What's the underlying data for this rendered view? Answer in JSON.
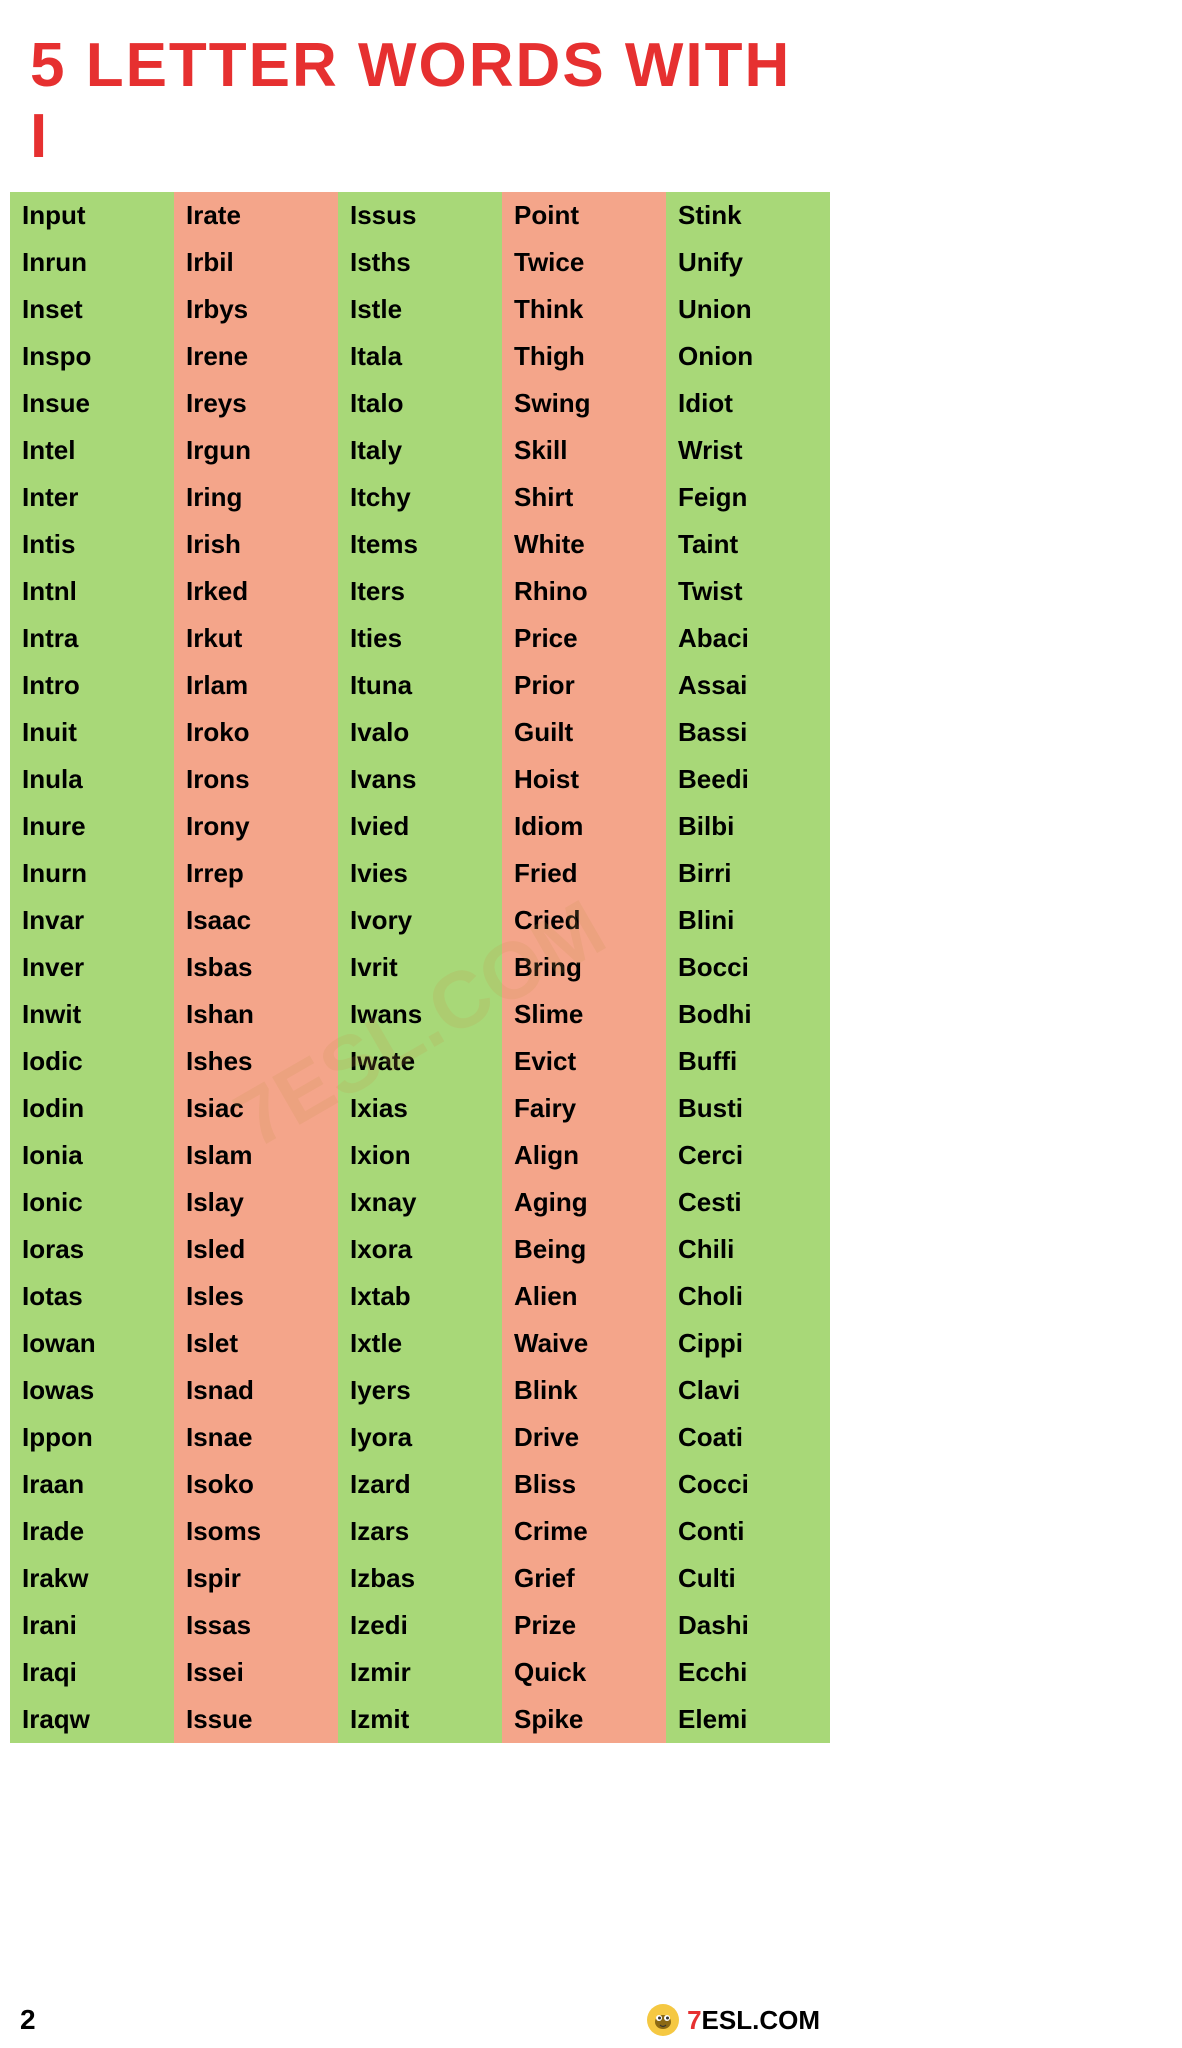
{
  "header": {
    "title": "5 LETTER WORDS WITH I"
  },
  "footer": {
    "page": "2",
    "logo_text": "ESL.COM"
  },
  "columns": [
    {
      "color_pattern": "green",
      "items": [
        "Input",
        "Inrun",
        "Inset",
        "Inspo",
        "Insue",
        "Intel",
        "Inter",
        "Intis",
        "Intnl",
        "Intra",
        "Intro",
        "Inuit",
        "Inula",
        "Inure",
        "Inurn",
        "Invar",
        "Inver",
        "Inwit",
        "Iodic",
        "Iodin",
        "Ionia",
        "Ionic",
        "Ioras",
        "Iotas",
        "Iowan",
        "Iowas",
        "Ippon",
        "Iraan",
        "Irade",
        "Irakw",
        "Irani",
        "Iraqi",
        "Iraqw"
      ]
    },
    {
      "color_pattern": "salmon",
      "items": [
        "Irate",
        "Irbil",
        "Irbys",
        "Irene",
        "Ireys",
        "Irgun",
        "Iring",
        "Irish",
        "Irked",
        "Irkut",
        "Irlam",
        "Iroko",
        "Irons",
        "Irony",
        "Irrep",
        "Isaac",
        "Isbas",
        "Ishan",
        "Ishes",
        "Isiac",
        "Islam",
        "Islay",
        "Isled",
        "Isles",
        "Islet",
        "Isnad",
        "Isnae",
        "Isoko",
        "Isoms",
        "Ispir",
        "Issas",
        "Issei",
        "Issue"
      ]
    },
    {
      "color_pattern": "green",
      "items": [
        "Issus",
        "Isths",
        "Istle",
        "Itala",
        "Italo",
        "Italy",
        "Itchy",
        "Items",
        "Iters",
        "Ities",
        "Ituna",
        "Ivalo",
        "Ivans",
        "Ivied",
        "Ivies",
        "Ivory",
        "Ivrit",
        "Iwans",
        "Iwate",
        "Ixias",
        "Ixion",
        "Ixnay",
        "Ixora",
        "Ixtab",
        "Ixtle",
        "Iyers",
        "Iyora",
        "Izard",
        "Izars",
        "Izbas",
        "Izedi",
        "Izmir",
        "Izmit"
      ]
    },
    {
      "color_pattern": "salmon",
      "items": [
        "Point",
        "Twice",
        "Think",
        "Thigh",
        "Swing",
        "Skill",
        "Shirt",
        "White",
        "Rhino",
        "Price",
        "Prior",
        "Guilt",
        "Hoist",
        "Idiom",
        "Fried",
        "Cried",
        "Bring",
        "Slime",
        "Evict",
        "Fairy",
        "Align",
        "Aging",
        "Being",
        "Alien",
        "Waive",
        "Blink",
        "Drive",
        "Bliss",
        "Crime",
        "Grief",
        "Prize",
        "Quick",
        "Spike"
      ]
    },
    {
      "color_pattern": "green",
      "items": [
        "Stink",
        "Unify",
        "Union",
        "Onion",
        "Idiot",
        "Wrist",
        "Feign",
        "Taint",
        "Twist",
        "Abaci",
        "Assai",
        "Bassi",
        "Beedi",
        "Bilbi",
        "Birri",
        "Blini",
        "Bocci",
        "Bodhi",
        "Buffi",
        "Busti",
        "Cerci",
        "Cesti",
        "Chili",
        "Choli",
        "Cippi",
        "Clavi",
        "Coati",
        "Cocci",
        "Conti",
        "Culti",
        "Dashi",
        "Ecchi",
        "Elemi"
      ]
    }
  ]
}
